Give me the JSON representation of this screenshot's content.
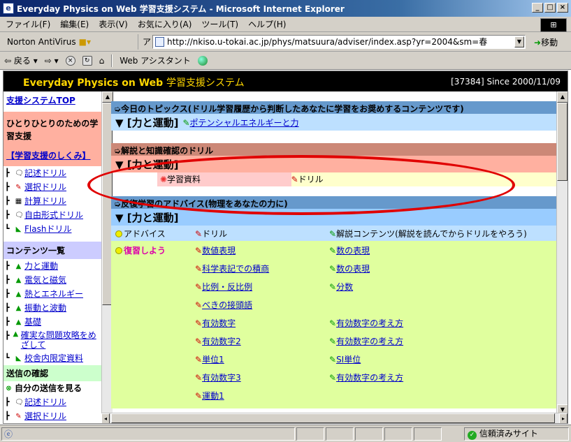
{
  "window": {
    "title": "Everyday Physics on Web 学習支援システム - Microsoft Internet Explorer",
    "min": "_",
    "max": "□",
    "close": "×"
  },
  "menu": [
    "ファイル(F)",
    "編集(E)",
    "表示(V)",
    "お気に入り(A)",
    "ツール(T)",
    "ヘルプ(H)"
  ],
  "toolbar": {
    "norton": "Norton AntiVirus",
    "address_label": "アドレス(D)",
    "url": "http://nkiso.u-tokai.ac.jp/phys/matsuura/adviser/index.asp?yr=2004&sm=春",
    "go": "移動",
    "back": "戻る",
    "assistant": "Web アシスタント"
  },
  "banner": {
    "title_en": "Everyday Physics on Web",
    "title_jp": "学習支援システム",
    "counter": "[37384]  Since 2000/11/09"
  },
  "left": {
    "top_link": "支援システムTOP",
    "intro": "ひとりひとりのための学習支援",
    "mechanism": "【学習支援のしくみ】",
    "drills": [
      "記述ドリル",
      "選択ドリル",
      "計算ドリル",
      "自由形式ドリル",
      "Flashドリル"
    ],
    "contents_head": "コンテンツ一覧",
    "contents": [
      "力と運動",
      "電気と磁気",
      "熱とエネルギー",
      "振動と波動",
      "基礎",
      "確実な問題攻略をめざして",
      "校舎内限定資料"
    ],
    "send_head": "送信の確認",
    "send_self": "自分の送信を見る",
    "send_items": [
      "記述ドリル",
      "選択ドリル"
    ]
  },
  "main": {
    "topics_head": "今日のトピックス(ドリル学習履歴から判断したあなたに学習をお奨めするコンテンツです)",
    "topic_title": "▼ [力と運動]",
    "topic_link": "ポテンシャルエネルギーと力",
    "kaisetsu_head": "解説と知識確認のドリル",
    "kaisetsu_title": "▼ [力と運動]",
    "kaisetsu_material": "学習資料",
    "kaisetsu_drill": "ドリル",
    "advice_head": "反復学習のアドバイス(物理をあなたの力に)",
    "advice_title": "▼ [力と運動]",
    "cols": [
      "アドバイス",
      "ドリル",
      "解説コンテンツ(解説を読んでからドリルをやろう)"
    ],
    "review_label": "復習しよう",
    "rows": [
      {
        "drill": "数値表現",
        "content": "数の表現"
      },
      {
        "drill": "科学表記での積商",
        "content": "数の表現"
      },
      {
        "drill": "比例・反比例",
        "content": "分数"
      },
      {
        "drill": "べきの接頭語",
        "content": ""
      },
      {
        "drill": "有効数字",
        "content": "有効数字の考え方"
      },
      {
        "drill": "有効数字2",
        "content": "有効数字の考え方"
      },
      {
        "drill": "単位1",
        "content": "SI単位"
      },
      {
        "drill": "有効数字3",
        "content": "有効数字の考え方"
      },
      {
        "drill": "運動1",
        "content": ""
      }
    ]
  },
  "status": {
    "zone": "信頼済みサイト"
  },
  "colors": {
    "annotation": "#e00000"
  }
}
